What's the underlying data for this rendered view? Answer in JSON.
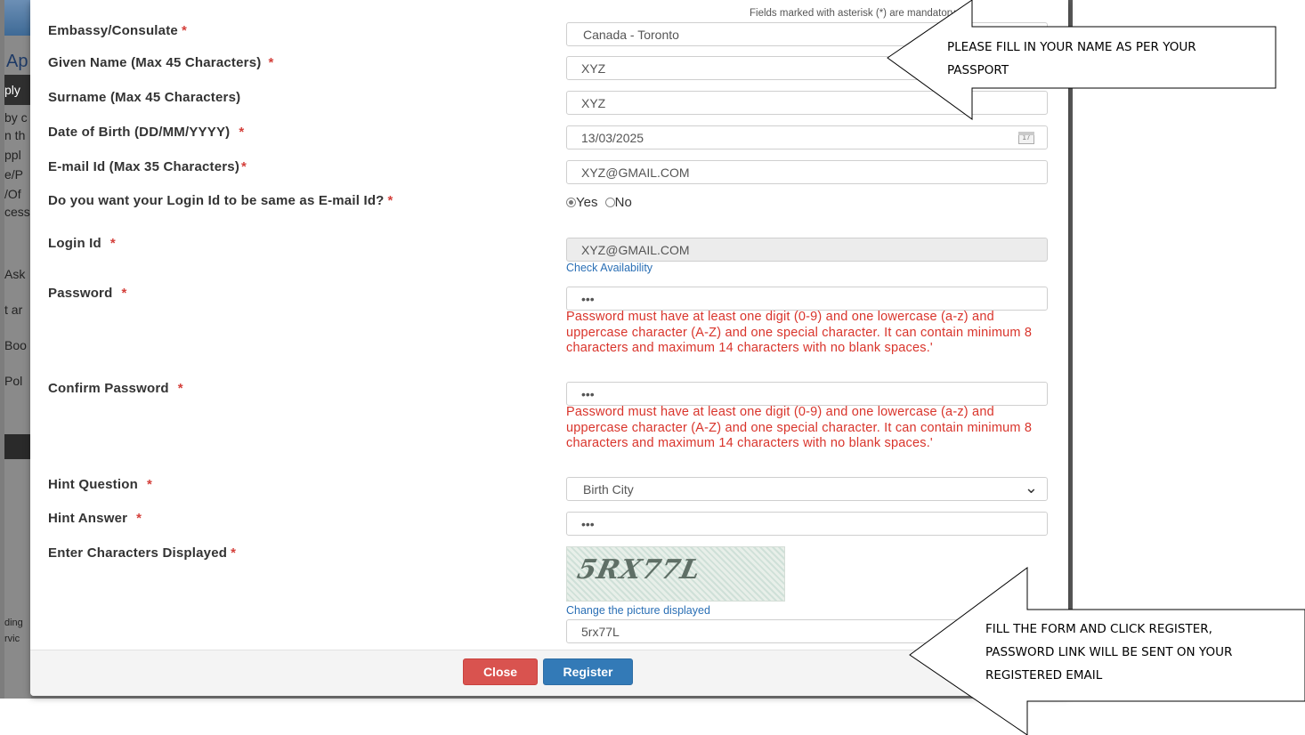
{
  "background": {
    "fragments": [
      "Ap",
      "ply",
      "by c",
      "n th",
      "ppl",
      "e/P",
      "/Of",
      "cess",
      "Ask",
      "t ar",
      "Boo",
      "Pol",
      "ding",
      "rvic"
    ]
  },
  "note": "Fields marked with asterisk (*) are mandatory",
  "form": {
    "embassy_label": "Embassy/Consulate",
    "embassy_value": "Canada - Toronto",
    "given_name_label": "Given Name (Max 45 Characters)",
    "given_name_value": "XYZ",
    "surname_label": "Surname (Max 45 Characters)",
    "surname_value": "XYZ",
    "dob_label": "Date of Birth (DD/MM/YYYY)",
    "dob_value": "13/03/2025",
    "dob_icon_text": "17",
    "email_label": "E-mail Id (Max 35 Characters)",
    "email_value": "XYZ@GMAIL.COM",
    "same_login_label": "Do you want your Login Id to be same as E-mail Id?",
    "radio_yes": "Yes",
    "radio_no": "No",
    "login_label": "Login Id",
    "login_value": "XYZ@GMAIL.COM",
    "check_availability": "Check Availability",
    "password_label": "Password",
    "password_value": "•••",
    "password_error": "Password must have at least one digit (0-9) and one lowercase (a-z) and uppercase character (A-Z) and one special character. It can contain minimum 8 characters and maximum 14 characters with no blank spaces.'",
    "confirm_label": "Confirm Password",
    "confirm_value": "•••",
    "confirm_error": "Password must have at least one digit (0-9) and one lowercase (a-z) and uppercase character (A-Z) and one special character. It can contain minimum 8 characters and maximum 14 characters with no blank spaces.'",
    "hint_q_label": "Hint Question",
    "hint_q_value": "Birth City",
    "hint_a_label": "Hint Answer",
    "hint_a_value": "•••",
    "captcha_label": "Enter Characters Displayed",
    "captcha_image_text": "5RX77L",
    "change_picture": "Change the picture displayed",
    "captcha_value": "5rx77L",
    "required_mark": "*"
  },
  "buttons": {
    "close": "Close",
    "register": "Register"
  },
  "callouts": {
    "top_line1": "PLEASE FILL IN YOUR NAME AS PER YOUR",
    "top_line2": "PASSPORT",
    "bottom_line1": "FILL THE FORM AND CLICK REGISTER,",
    "bottom_line2": "PASSWORD LINK WILL BE SENT ON YOUR",
    "bottom_line3": "REGISTERED EMAIL"
  },
  "colors": {
    "required": "#d43f3a",
    "error_text": "#d9342b",
    "link": "#2a6fb5",
    "close_button": "#d9534f",
    "register_button": "#337ab7"
  }
}
